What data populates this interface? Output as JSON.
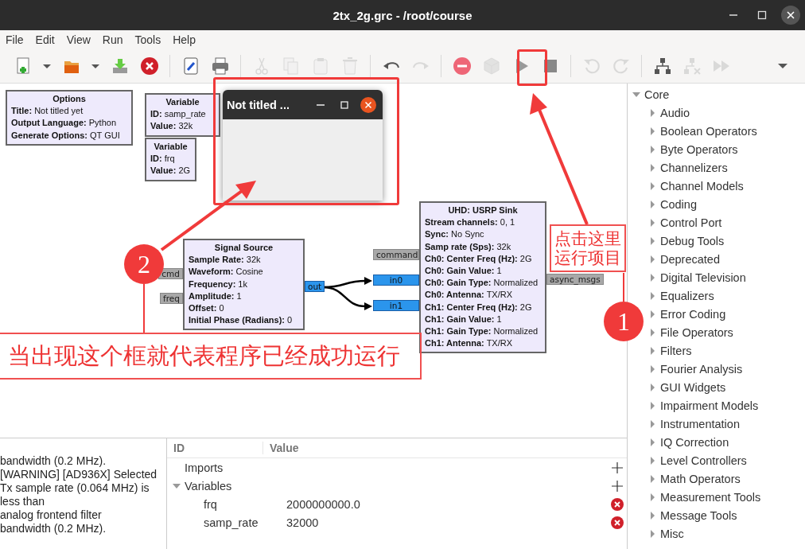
{
  "window": {
    "title": "2tx_2g.grc - /root/course"
  },
  "menu": [
    "File",
    "Edit",
    "View",
    "Run",
    "Tools",
    "Help"
  ],
  "toolbar": [
    {
      "kind": "new",
      "disabled": false
    },
    {
      "kind": "dropdown",
      "disabled": false
    },
    {
      "kind": "open",
      "disabled": false
    },
    {
      "kind": "dropdown",
      "disabled": false
    },
    {
      "kind": "save",
      "disabled": false
    },
    {
      "kind": "close",
      "disabled": false
    },
    {
      "kind": "separator"
    },
    {
      "kind": "edit",
      "disabled": false
    },
    {
      "kind": "print",
      "disabled": false
    },
    {
      "kind": "separator"
    },
    {
      "kind": "cut",
      "disabled": true
    },
    {
      "kind": "copy",
      "disabled": true
    },
    {
      "kind": "paste",
      "disabled": true
    },
    {
      "kind": "delete",
      "disabled": true
    },
    {
      "kind": "separator"
    },
    {
      "kind": "undo",
      "disabled": false
    },
    {
      "kind": "redo",
      "disabled": true
    },
    {
      "kind": "separator"
    },
    {
      "kind": "disable",
      "disabled": false
    },
    {
      "kind": "bypass",
      "disabled": true
    },
    {
      "kind": "run",
      "disabled": false
    },
    {
      "kind": "stop",
      "disabled": false
    },
    {
      "kind": "separator"
    },
    {
      "kind": "rotate_ccw",
      "disabled": true
    },
    {
      "kind": "rotate_cw",
      "disabled": true
    },
    {
      "kind": "separator"
    },
    {
      "kind": "find",
      "disabled": false
    },
    {
      "kind": "find_clear",
      "disabled": true
    },
    {
      "kind": "forward",
      "disabled": true
    },
    {
      "kind": "more",
      "disabled": false
    }
  ],
  "canvas": {
    "blocks": [
      {
        "title": "Options",
        "params": [
          {
            "label": "Title:",
            "value": "Not titled yet"
          },
          {
            "label": "Output Language:",
            "value": "Python"
          },
          {
            "label": "Generate Options:",
            "value": "QT GUI"
          }
        ]
      },
      {
        "title": "Variable",
        "params": [
          {
            "label": "ID:",
            "value": "samp_rate"
          },
          {
            "label": "Value:",
            "value": "32k"
          }
        ]
      },
      {
        "title": "Variable",
        "params": [
          {
            "label": "ID:",
            "value": "frq"
          },
          {
            "label": "Value:",
            "value": "2G"
          }
        ]
      },
      {
        "title": "Signal Source",
        "params": [
          {
            "label": "Sample Rate:",
            "value": "32k"
          },
          {
            "label": "Waveform:",
            "value": "Cosine"
          },
          {
            "label": "Frequency:",
            "value": "1k"
          },
          {
            "label": "Amplitude:",
            "value": "1"
          },
          {
            "label": "Offset:",
            "value": "0"
          },
          {
            "label": "Initial Phase (Radians):",
            "value": "0"
          }
        ],
        "inputs": [
          {
            "label": "cmd",
            "kind": "message"
          },
          {
            "label": "freq",
            "kind": "message"
          }
        ],
        "outputs": [
          {
            "label": "out",
            "kind": "stream"
          }
        ]
      },
      {
        "title": "UHD: USRP Sink",
        "params": [
          {
            "label": "Stream channels:",
            "value": "0, 1"
          },
          {
            "label": "Sync:",
            "value": "No Sync"
          },
          {
            "label": "Samp rate (Sps):",
            "value": "32k"
          },
          {
            "label": "Ch0: Center Freq (Hz):",
            "value": "2G"
          },
          {
            "label": "Ch0: Gain Value:",
            "value": "1"
          },
          {
            "label": "Ch0: Gain Type:",
            "value": "Normalized"
          },
          {
            "label": "Ch0: Antenna:",
            "value": "TX/RX"
          },
          {
            "label": "Ch1: Center Freq (Hz):",
            "value": "2G"
          },
          {
            "label": "Ch1: Gain Value:",
            "value": "1"
          },
          {
            "label": "Ch1: Gain Type:",
            "value": "Normalized"
          },
          {
            "label": "Ch1: Antenna:",
            "value": "TX/RX"
          }
        ],
        "inputs": [
          {
            "label": "command",
            "kind": "message"
          },
          {
            "label": "in0",
            "kind": "stream"
          },
          {
            "label": "in1",
            "kind": "stream"
          }
        ],
        "outputs": [
          {
            "label": "async_msgs",
            "kind": "message"
          }
        ]
      }
    ]
  },
  "popup": {
    "title": "Not titled ..."
  },
  "log": [
    "bandwidth (0.2 MHz).",
    "[WARNING] [AD936X] Selected",
    "Tx sample rate (0.064 MHz) is",
    "less than",
    "analog frontend filter",
    "bandwidth (0.2 MHz)."
  ],
  "variables_panel": {
    "columns": [
      "ID",
      "Value"
    ],
    "rows": [
      {
        "id": "Imports"
      },
      {
        "id": "Variables",
        "expanded": true,
        "children": [
          {
            "id": "frq",
            "value": "2000000000.0"
          },
          {
            "id": "samp_rate",
            "value": "32000"
          }
        ]
      }
    ]
  },
  "tree": {
    "items": [
      {
        "label": "Core",
        "expanded": true,
        "children": [
          {
            "label": "Audio",
            "expanded": false
          },
          {
            "label": "Boolean Operators",
            "expanded": false
          },
          {
            "label": "Byte Operators",
            "expanded": false
          },
          {
            "label": "Channelizers",
            "expanded": false
          },
          {
            "label": "Channel Models",
            "expanded": false
          },
          {
            "label": "Coding",
            "expanded": false
          },
          {
            "label": "Control Port",
            "expanded": false
          },
          {
            "label": "Debug Tools",
            "expanded": false
          },
          {
            "label": "Deprecated",
            "expanded": false
          },
          {
            "label": "Digital Television",
            "expanded": false
          },
          {
            "label": "Equalizers",
            "expanded": false
          },
          {
            "label": "Error Coding",
            "expanded": false
          },
          {
            "label": "File Operators",
            "expanded": false
          },
          {
            "label": "Filters",
            "expanded": false
          },
          {
            "label": "Fourier Analysis",
            "expanded": false
          },
          {
            "label": "GUI Widgets",
            "expanded": false
          },
          {
            "label": "Impairment Models",
            "expanded": false
          },
          {
            "label": "Instrumentation",
            "expanded": false
          },
          {
            "label": "IQ Correction",
            "expanded": false
          },
          {
            "label": "Level Controllers",
            "expanded": false
          },
          {
            "label": "Math Operators",
            "expanded": false
          },
          {
            "label": "Measurement Tools",
            "expanded": false
          },
          {
            "label": "Message Tools",
            "expanded": false
          },
          {
            "label": "Misc",
            "expanded": false
          }
        ]
      }
    ]
  },
  "annotations": {
    "run_hint": "点击这里运行项目",
    "result_hint": "当出现这个框就代表程序已经成功运行",
    "step_1": "1",
    "step_2": "2"
  }
}
